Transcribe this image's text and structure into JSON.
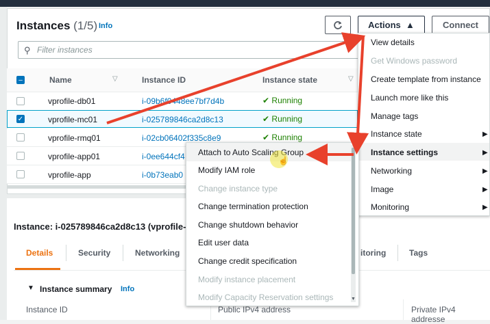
{
  "header": {
    "title": "Instances",
    "count": "(1/5)",
    "info": "Info",
    "actions_label": "Actions",
    "connect_label": "Connect"
  },
  "search": {
    "placeholder": "Filter instances"
  },
  "table": {
    "columns": [
      "Name",
      "Instance ID",
      "Instance state"
    ],
    "rows": [
      {
        "name": "vprofile-db01",
        "id": "i-09b6f0448ee7bf7d4b",
        "state": "Running",
        "selected": false
      },
      {
        "name": "vprofile-mc01",
        "id": "i-025789846ca2d8c13",
        "state": "Running",
        "selected": true
      },
      {
        "name": "vprofile-rmq01",
        "id": "i-02cb06402f335c8e9",
        "state": "Running",
        "selected": false
      },
      {
        "name": "vprofile-app01",
        "id": "i-0ee644cf4",
        "state": "",
        "selected": false
      },
      {
        "name": "vprofile-app",
        "id": "i-0b73eab0",
        "state": "",
        "selected": false
      }
    ]
  },
  "actions_menu": {
    "items": [
      {
        "label": "View details",
        "disabled": false,
        "submenu": false
      },
      {
        "label": "Get Windows password",
        "disabled": true,
        "submenu": false
      },
      {
        "label": "Create template from instance",
        "disabled": false,
        "submenu": false
      },
      {
        "label": "Launch more like this",
        "disabled": false,
        "submenu": false
      },
      {
        "label": "Manage tags",
        "disabled": false,
        "submenu": false
      },
      {
        "label": "Instance state",
        "disabled": false,
        "submenu": true
      },
      {
        "label": "Instance settings",
        "disabled": false,
        "submenu": true,
        "highlighted": true
      },
      {
        "label": "Networking",
        "disabled": false,
        "submenu": true
      },
      {
        "label": "Image",
        "disabled": false,
        "submenu": true
      },
      {
        "label": "Monitoring",
        "disabled": false,
        "submenu": true
      }
    ]
  },
  "settings_submenu": {
    "items": [
      {
        "label": "Attach to Auto Scaling Group",
        "disabled": false,
        "highlighted": true
      },
      {
        "label": "Modify IAM role",
        "disabled": false
      },
      {
        "label": "Change instance type",
        "disabled": true
      },
      {
        "label": "Change termination protection",
        "disabled": false
      },
      {
        "label": "Change shutdown behavior",
        "disabled": false
      },
      {
        "label": "Edit user data",
        "disabled": false
      },
      {
        "label": "Change credit specification",
        "disabled": false
      },
      {
        "label": "Modify instance placement",
        "disabled": true
      },
      {
        "label": "Modify Capacity Reservation settings",
        "disabled": true
      }
    ]
  },
  "detail": {
    "title": "Instance: i-025789846ca2d8c13 (vprofile-",
    "tabs": [
      "Details",
      "Security",
      "Networking",
      "itoring",
      "Tags"
    ],
    "summary_label": "Instance summary",
    "summary_info": "Info",
    "fields": [
      "Instance ID",
      "Public IPv4 address",
      "Private IPv4 addresse"
    ]
  },
  "colors": {
    "accent": "#ec7211",
    "link": "#0073bb",
    "running": "#1d8102",
    "annotation": "#e8412c"
  }
}
